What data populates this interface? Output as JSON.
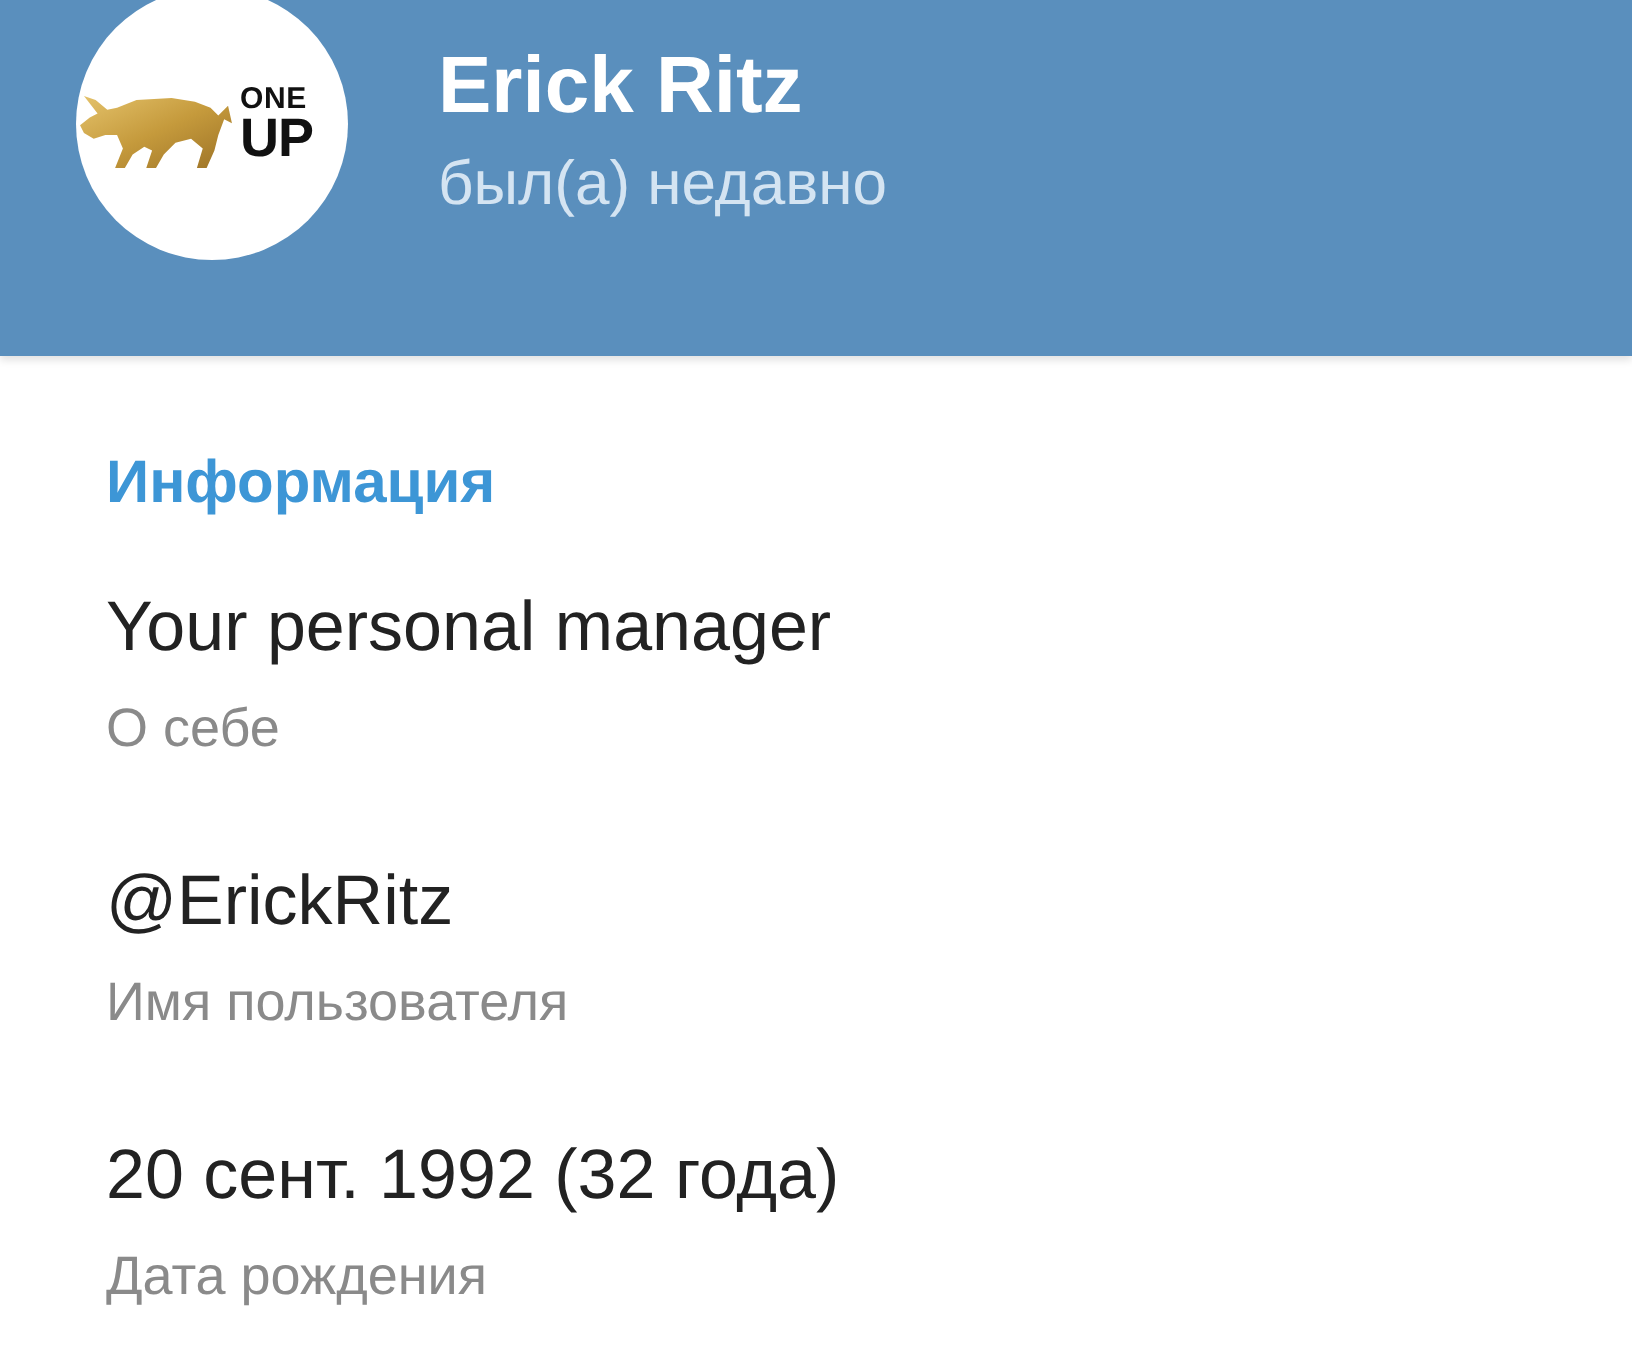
{
  "header": {
    "avatar": {
      "logo_text": [
        "ONE",
        "UP"
      ]
    },
    "name": "Erick Ritz",
    "status": "был(а) недавно"
  },
  "info": {
    "title": "Информация",
    "items": [
      {
        "value": "Your personal manager",
        "label": "О себе"
      },
      {
        "value": "@ErickRitz",
        "label": "Имя пользователя"
      },
      {
        "value": "20 сент. 1992 (32 года)",
        "label": "Дата рождения"
      }
    ]
  }
}
